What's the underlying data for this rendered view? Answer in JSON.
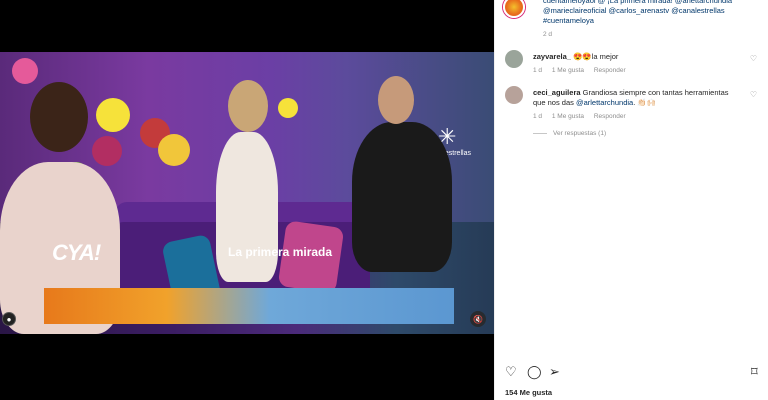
{
  "post": {
    "caption_text": "cuentameloyaoi @ ¡La primera mirada! @arlettarchundia @marieclaireoficial @carlos_arenastv @canalestrellas #cuentameloya",
    "caption_time": "2 d",
    "video_lower_third_logo": "CYA!",
    "video_lower_third_title": "La primera mirada",
    "video_channel_logo_text": "las estrellas"
  },
  "comments": [
    {
      "user": "zayvarela_",
      "text": "😍😍la mejor",
      "time": "1 d",
      "likes_label": "1 Me gusta",
      "reply_label": "Responder"
    },
    {
      "user": "ceci_aguilera",
      "text_before": "Grandiosa siempre con tantas herramientas que nos das",
      "mention": "@arlettarchundia",
      "text_after": ". 👏🏻🙌🏻",
      "time": "1 d",
      "likes_label": "1 Me gusta",
      "reply_label": "Responder",
      "replies_label": "Ver respuestas (1)"
    }
  ],
  "footer": {
    "likes_count": "154 Me gusta"
  },
  "icons": {
    "heart": "heart-icon",
    "comment": "comment-icon",
    "share": "share-icon",
    "save": "bookmark-icon"
  },
  "colors": {
    "link": "#00376b",
    "muted": "#8e8e8e",
    "text": "#262626"
  }
}
